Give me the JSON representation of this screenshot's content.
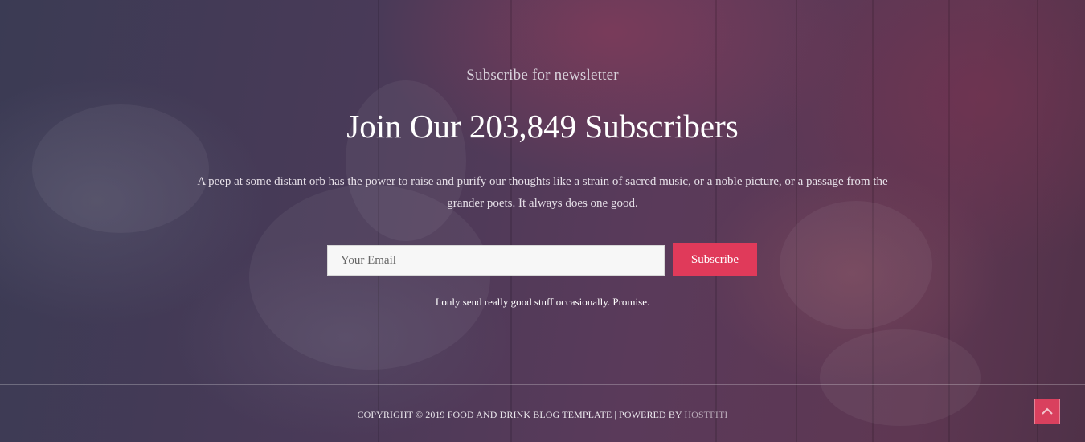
{
  "newsletter": {
    "eyebrow": "Subscribe for newsletter",
    "headline": "Join Our 203,849 Subscribers",
    "description": "A peep at some distant orb has the power to raise and purify our thoughts like a strain of sacred music, or a noble picture, or a passage from the grander poets. It always does one good.",
    "email_placeholder": "Your Email",
    "email_value": "",
    "subscribe_label": "Subscribe",
    "promise": "I only send really good stuff occasionally. Promise."
  },
  "footer": {
    "copyright_text": "COPYRIGHT © 2019 FOOD AND DRINK BLOG TEMPLATE | POWERED BY ",
    "powered_by_link": "HOSTFITI"
  },
  "back_to_top": {
    "icon": "chevron-up-icon"
  },
  "colors": {
    "accent": "#e03a5a",
    "background_overlay": "#4a3a58",
    "text": "#ffffff"
  }
}
